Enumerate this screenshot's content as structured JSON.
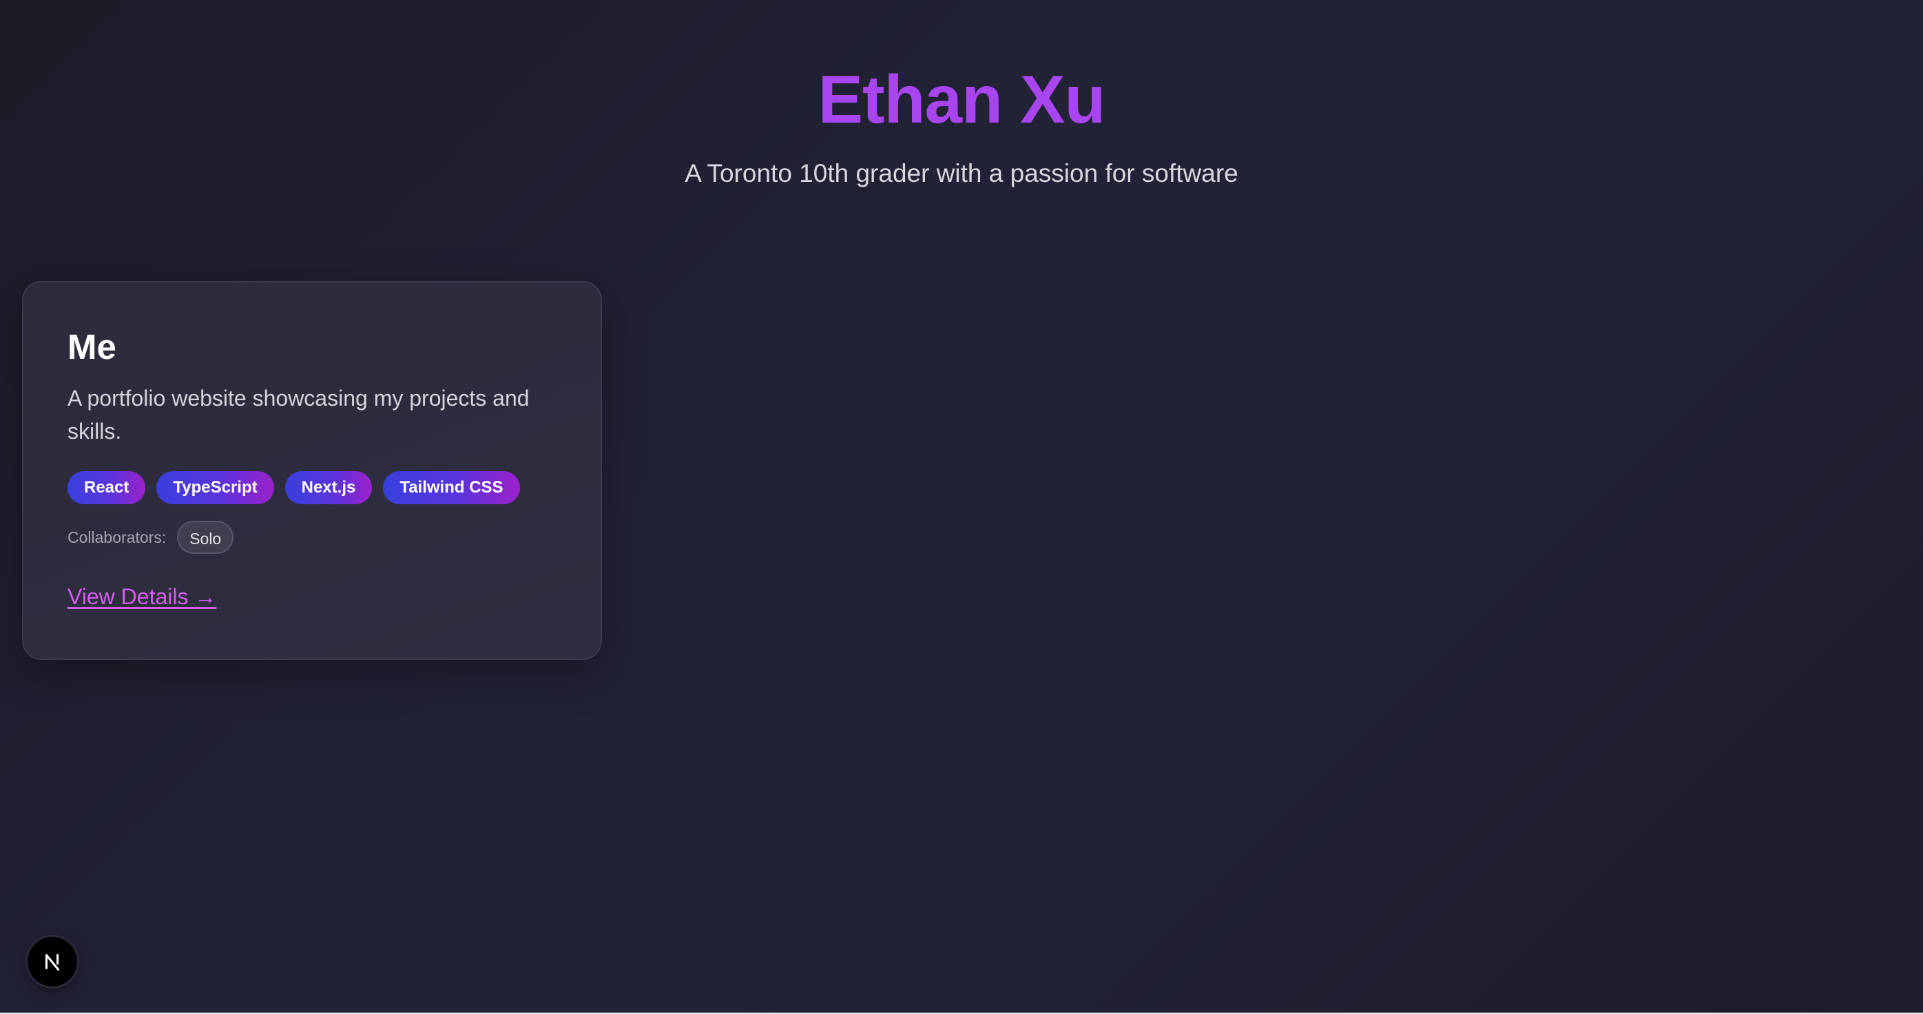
{
  "hero": {
    "title": "Ethan Xu",
    "subtitle": "A Toronto 10th grader with a passion for software"
  },
  "projects": [
    {
      "title": "Me",
      "description": "A portfolio website showcasing my projects and skills.",
      "tags": [
        "React",
        "TypeScript",
        "Next.js",
        "Tailwind CSS"
      ],
      "collaborators_label": "Collaborators:",
      "collaborators": [
        "Solo"
      ],
      "link_label": "View Details →"
    }
  ],
  "devtools": {
    "icon": "nextjs-logo-icon"
  },
  "colors": {
    "accent": "#a745ee",
    "link": "#d15ef0",
    "tag_gradient_start": "#3a3fdc",
    "tag_gradient_end": "#9a22c8",
    "background": "#212134"
  }
}
